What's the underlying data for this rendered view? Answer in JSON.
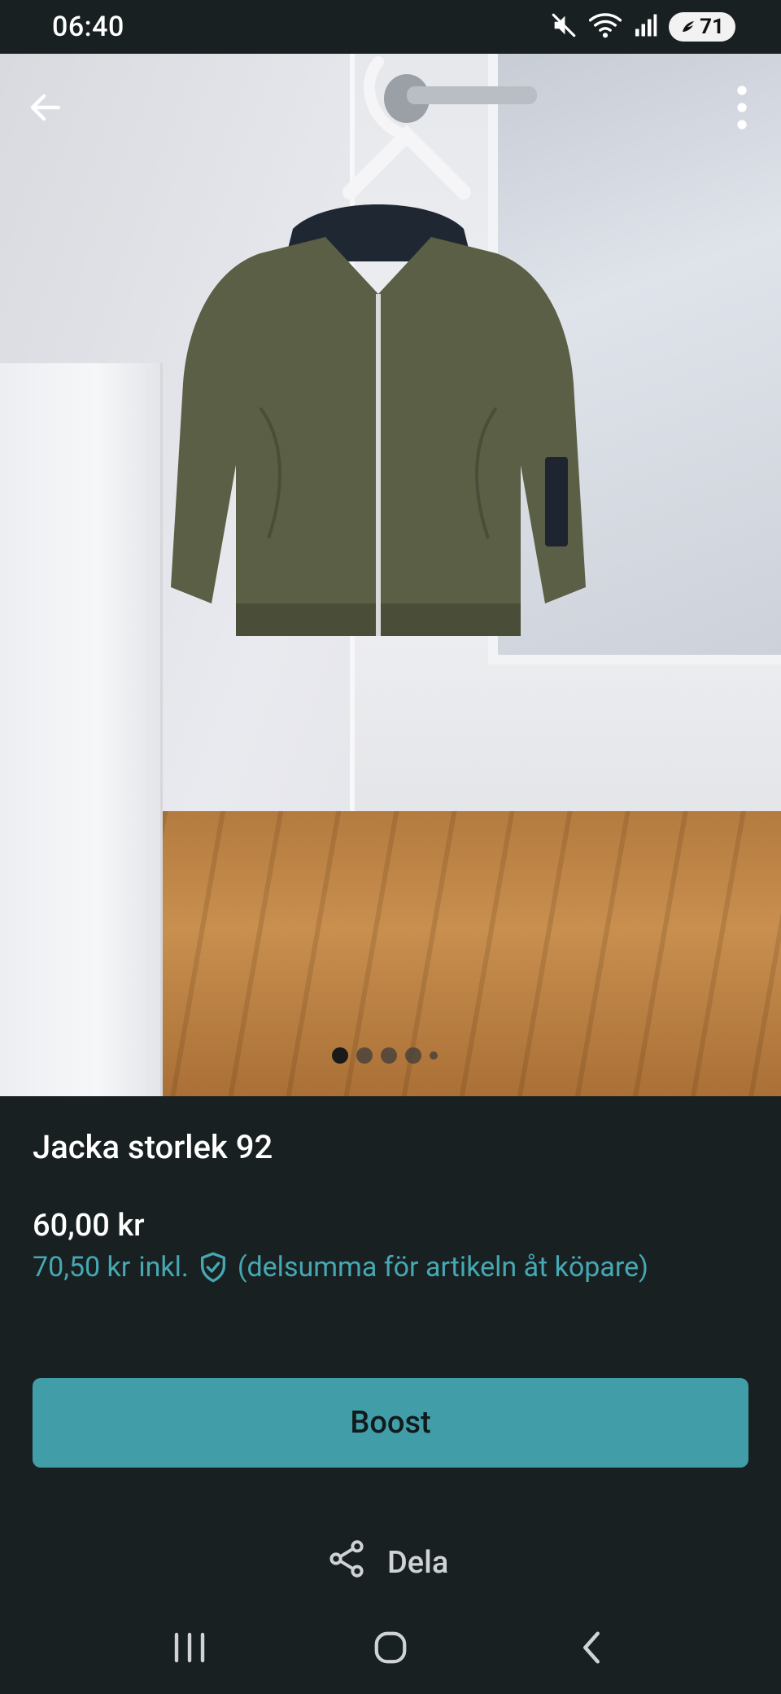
{
  "status_bar": {
    "time": "06:40",
    "battery": "71",
    "icons": [
      "mute-icon",
      "wifi-icon",
      "signal-icon",
      "battery-icon"
    ]
  },
  "listing": {
    "title": "Jacka storlek 92",
    "price": "60,00 kr",
    "buyer_price": "70,50 kr",
    "buyer_incl": "inkl.",
    "buyer_note": "(delsumma för artikeln åt köpare)",
    "image_count": 5,
    "active_image_index": 0
  },
  "actions": {
    "boost_label": "Boost",
    "share_label": "Dela"
  },
  "colors": {
    "background": "#192022",
    "accent": "#419ea9",
    "accent_text": "#45a8b2"
  }
}
